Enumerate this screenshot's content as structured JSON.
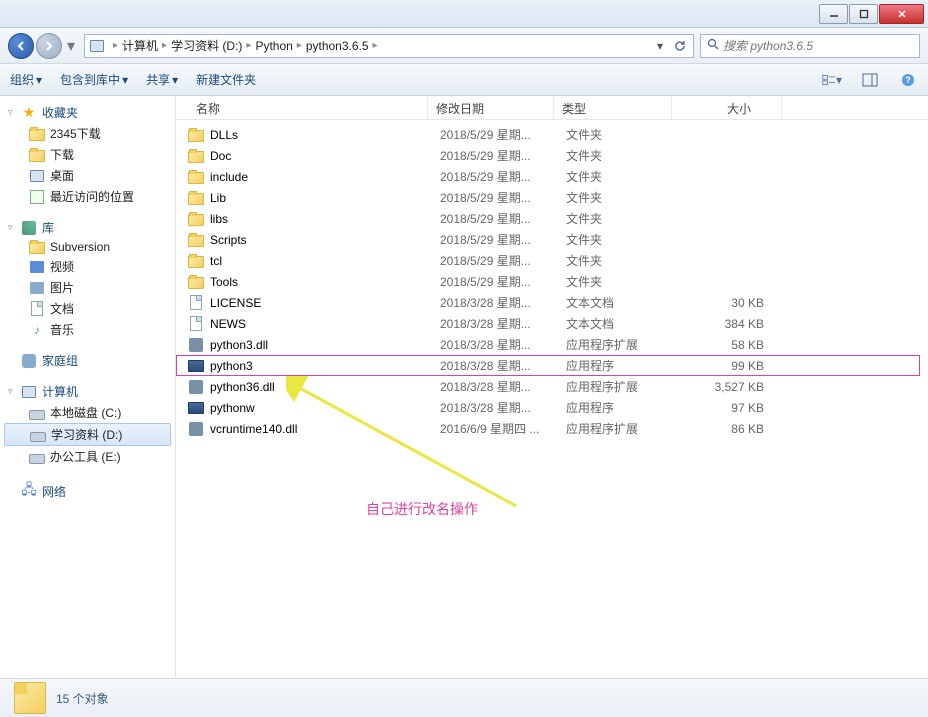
{
  "breadcrumb": {
    "items": [
      "计算机",
      "学习资料 (D:)",
      "Python",
      "python3.6.5"
    ]
  },
  "search": {
    "placeholder": "搜索 python3.6.5"
  },
  "toolbar": {
    "organize": "组织",
    "include": "包含到库中",
    "share": "共享",
    "newfolder": "新建文件夹"
  },
  "sidebar": {
    "favorites": {
      "label": "收藏夹",
      "items": [
        "2345下载",
        "下载",
        "桌面",
        "最近访问的位置"
      ]
    },
    "libraries": {
      "label": "库",
      "items": [
        "Subversion",
        "视频",
        "图片",
        "文档",
        "音乐"
      ]
    },
    "homegroup": "家庭组",
    "computer": {
      "label": "计算机",
      "drives": [
        "本地磁盘 (C:)",
        "学习资料 (D:)",
        "办公工具 (E:)"
      ]
    },
    "network": "网络"
  },
  "columns": {
    "name": "名称",
    "date": "修改日期",
    "type": "类型",
    "size": "大小"
  },
  "files": [
    {
      "icon": "folder",
      "name": "DLLs",
      "date": "2018/5/29 星期...",
      "type": "文件夹",
      "size": ""
    },
    {
      "icon": "folder",
      "name": "Doc",
      "date": "2018/5/29 星期...",
      "type": "文件夹",
      "size": ""
    },
    {
      "icon": "folder",
      "name": "include",
      "date": "2018/5/29 星期...",
      "type": "文件夹",
      "size": ""
    },
    {
      "icon": "folder",
      "name": "Lib",
      "date": "2018/5/29 星期...",
      "type": "文件夹",
      "size": ""
    },
    {
      "icon": "folder",
      "name": "libs",
      "date": "2018/5/29 星期...",
      "type": "文件夹",
      "size": ""
    },
    {
      "icon": "folder",
      "name": "Scripts",
      "date": "2018/5/29 星期...",
      "type": "文件夹",
      "size": ""
    },
    {
      "icon": "folder",
      "name": "tcl",
      "date": "2018/5/29 星期...",
      "type": "文件夹",
      "size": ""
    },
    {
      "icon": "folder",
      "name": "Tools",
      "date": "2018/5/29 星期...",
      "type": "文件夹",
      "size": ""
    },
    {
      "icon": "doc",
      "name": "LICENSE",
      "date": "2018/3/28 星期...",
      "type": "文本文档",
      "size": "30 KB"
    },
    {
      "icon": "doc",
      "name": "NEWS",
      "date": "2018/3/28 星期...",
      "type": "文本文档",
      "size": "384 KB"
    },
    {
      "icon": "gear",
      "name": "python3.dll",
      "date": "2018/3/28 星期...",
      "type": "应用程序扩展",
      "size": "58 KB"
    },
    {
      "icon": "exe",
      "name": "python3",
      "date": "2018/3/28 星期...",
      "type": "应用程序",
      "size": "99 KB",
      "highlight": true
    },
    {
      "icon": "gear",
      "name": "python36.dll",
      "date": "2018/3/28 星期...",
      "type": "应用程序扩展",
      "size": "3,527 KB"
    },
    {
      "icon": "exe",
      "name": "pythonw",
      "date": "2018/3/28 星期...",
      "type": "应用程序",
      "size": "97 KB"
    },
    {
      "icon": "gear",
      "name": "vcruntime140.dll",
      "date": "2016/6/9 星期四 ...",
      "type": "应用程序扩展",
      "size": "86 KB"
    }
  ],
  "annotation": "自己进行改名操作",
  "status": "15 个对象"
}
